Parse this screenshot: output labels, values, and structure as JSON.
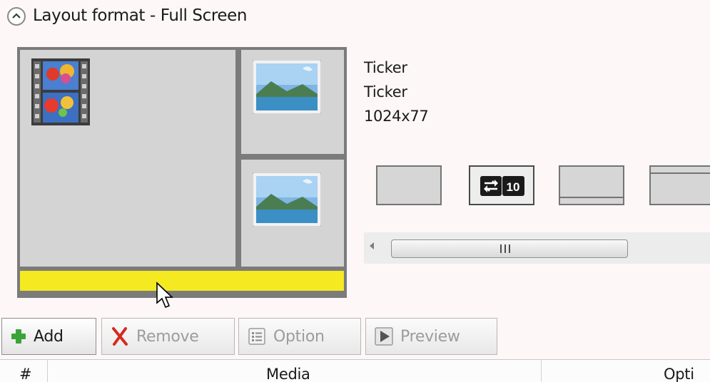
{
  "header": {
    "title": "Layout format - Full Screen",
    "collapse_icon": "chevron-up-icon"
  },
  "layout_preview": {
    "regions": [
      {
        "name": "main-region",
        "content_icon": "video-film-icon"
      },
      {
        "name": "side-region-top",
        "content_icon": "image-landscape-icon"
      },
      {
        "name": "side-region-bottom",
        "content_icon": "image-landscape-icon"
      },
      {
        "name": "ticker-region",
        "color": "#f5e922"
      }
    ]
  },
  "selected_region": {
    "line1": "Ticker",
    "line2": "Ticker",
    "size": "1024x77"
  },
  "layout_options": {
    "ticker_badge_number": "10"
  },
  "scrollbar": {
    "left_arrow_icon": "arrow-left-icon"
  },
  "toolbar": {
    "add_label": "Add",
    "remove_label": "Remove",
    "option_label": "Option",
    "preview_label": "Preview"
  },
  "table": {
    "columns": [
      "#",
      "Media",
      "Opti"
    ]
  },
  "colors": {
    "ticker_yellow": "#f5e922",
    "add_green": "#3aa43a",
    "remove_red": "#d42a1e"
  }
}
